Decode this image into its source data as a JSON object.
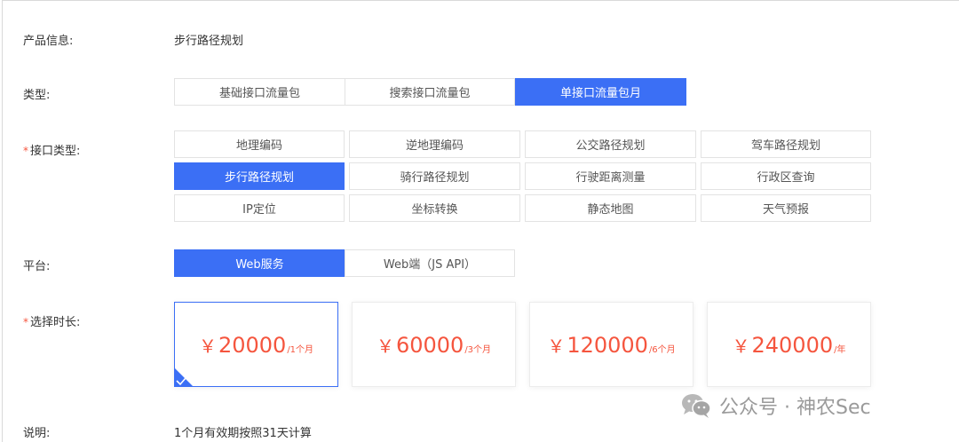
{
  "product": {
    "label": "产品信息:",
    "value": "步行路径规划"
  },
  "type": {
    "label": "类型:",
    "options": [
      "基础接口流量包",
      "搜索接口流量包",
      "单接口流量包月"
    ],
    "selected": "单接口流量包月"
  },
  "api_type": {
    "required_mark": "*",
    "label": "接口类型:",
    "options": [
      "地理编码",
      "逆地理编码",
      "公交路径规划",
      "驾车路径规划",
      "步行路径规划",
      "骑行路径规划",
      "行驶距离测量",
      "行政区查询",
      "IP定位",
      "坐标转换",
      "静态地图",
      "天气预报"
    ],
    "selected": "步行路径规划"
  },
  "platform": {
    "label": "平台:",
    "options": [
      "Web服务",
      "Web端（JS API）"
    ],
    "selected": "Web服务"
  },
  "duration": {
    "required_mark": "*",
    "label": "选择时长:",
    "cards": [
      {
        "currency": "￥",
        "amount": "20000",
        "unit": "/1个月"
      },
      {
        "currency": "￥",
        "amount": "60000",
        "unit": "/3个月"
      },
      {
        "currency": "￥",
        "amount": "120000",
        "unit": "/6个月"
      },
      {
        "currency": "￥",
        "amount": "240000",
        "unit": "/年"
      }
    ],
    "selected_index": 0
  },
  "note": {
    "label": "说明:",
    "value": "1个月有效期按照31天计算"
  },
  "watermark": {
    "text": "公众号 · 神农Sec"
  },
  "colors": {
    "accent": "#3b6ff5",
    "price": "#f5553e",
    "required": "#f5553e"
  },
  "icons": {
    "selected_corner": "checkmark-icon",
    "watermark": "wechat-icon"
  }
}
